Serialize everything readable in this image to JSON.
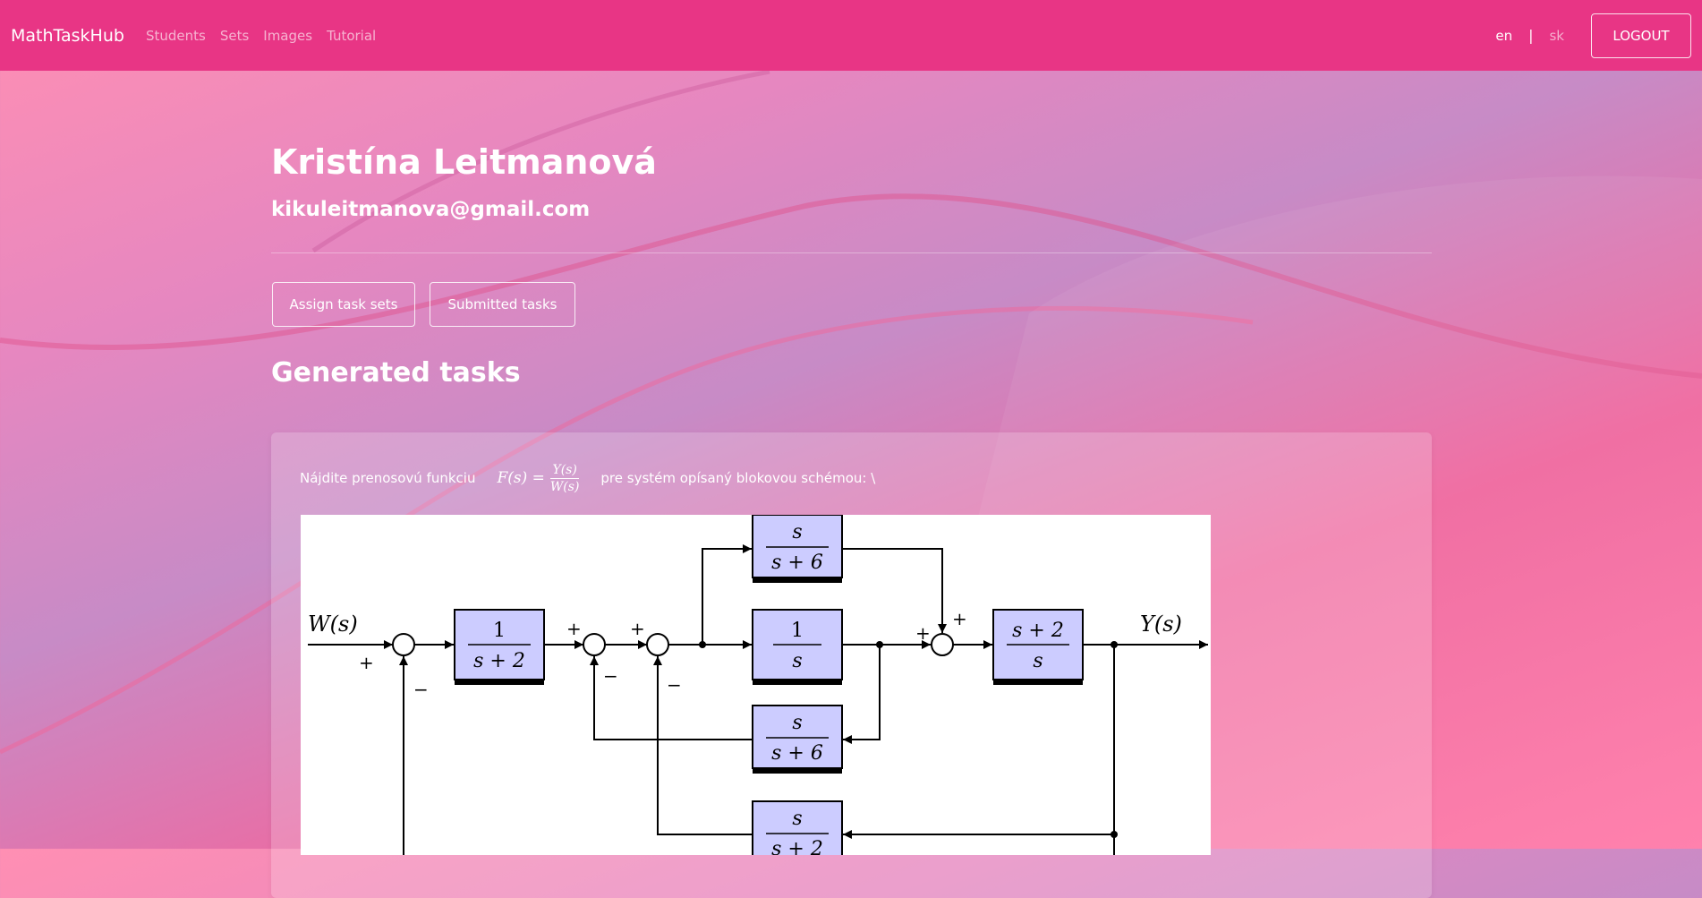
{
  "navbar": {
    "brand": "MathTaskHub",
    "links": [
      "Students",
      "Sets",
      "Images",
      "Tutorial"
    ],
    "lang_en": "en",
    "lang_sep": "|",
    "lang_sk": "sk",
    "logout": "LOGOUT"
  },
  "student": {
    "name": "Kristína Leitmanová",
    "email": "kikuleitmanova@gmail.com"
  },
  "actions": {
    "assign": "Assign task sets",
    "submitted": "Submitted tasks"
  },
  "section_title": "Generated tasks",
  "task": {
    "prefix": "Nájdite prenosovú funkciu",
    "formula_lhs": "F(s) =",
    "formula_num": "Y(s)",
    "formula_den": "W(s)",
    "suffix": "pre systém opísaný blokovou schémou: \\"
  },
  "diagram": {
    "input_label": "W(s)",
    "output_label": "Y(s)",
    "blocks": [
      {
        "num": "1",
        "den": "s + 2"
      },
      {
        "num": "s",
        "den": "s + 6"
      },
      {
        "num": "1",
        "den": "s"
      },
      {
        "num": "s + 2",
        "den": "s"
      },
      {
        "num": "s",
        "den": "s + 6"
      },
      {
        "num": "s",
        "den": "s + 2"
      }
    ],
    "signs": [
      "+",
      "−",
      "+",
      "−",
      "+",
      "−",
      "+",
      "+"
    ]
  },
  "colors": {
    "navbar": "#e83585",
    "block_fill": "#ccccff"
  }
}
